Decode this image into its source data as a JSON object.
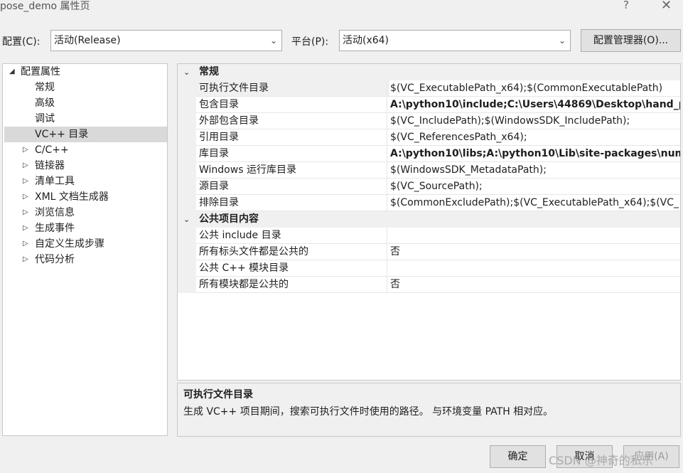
{
  "window": {
    "title": "pose_demo 属性页",
    "help_glyph": "?",
    "close_glyph": "✕"
  },
  "toolbar": {
    "config_label": "配置(C):",
    "config_value": "活动(Release)",
    "platform_label": "平台(P):",
    "platform_value": "活动(x64)",
    "manager_button": "配置管理器(O)..."
  },
  "tree": {
    "root": "配置属性",
    "children": [
      "常规",
      "高级",
      "调试",
      "VC++ 目录"
    ],
    "collapsed": [
      "C/C++",
      "链接器",
      "清单工具",
      "XML 文档生成器",
      "浏览信息",
      "生成事件",
      "自定义生成步骤",
      "代码分析"
    ],
    "selected": "VC++ 目录"
  },
  "grid": {
    "categories": [
      {
        "name": "常规",
        "rows": [
          {
            "name": "可执行文件目录",
            "value": "$(VC_ExecutablePath_x64);$(CommonExecutablePath)",
            "bold": false
          },
          {
            "name": "包含目录",
            "value": "A:\\python10\\include;C:\\Users\\44869\\Desktop\\hand_p",
            "bold": true
          },
          {
            "name": "外部包含目录",
            "value": "$(VC_IncludePath);$(WindowsSDK_IncludePath);",
            "bold": false
          },
          {
            "name": "引用目录",
            "value": "$(VC_ReferencesPath_x64);",
            "bold": false
          },
          {
            "name": "库目录",
            "value": "A:\\python10\\libs;A:\\python10\\Lib\\site-packages\\num",
            "bold": true
          },
          {
            "name": "Windows 运行库目录",
            "value": "$(WindowsSDK_MetadataPath);",
            "bold": false
          },
          {
            "name": "源目录",
            "value": "$(VC_SourcePath);",
            "bold": false
          },
          {
            "name": "排除目录",
            "value": "$(CommonExcludePath);$(VC_ExecutablePath_x64);$(VC_",
            "bold": false
          }
        ]
      },
      {
        "name": "公共项目内容",
        "rows": [
          {
            "name": "公共 include 目录",
            "value": "",
            "bold": false
          },
          {
            "name": "所有标头文件都是公共的",
            "value": "否",
            "bold": false
          },
          {
            "name": "公共 C++ 模块目录",
            "value": "",
            "bold": false
          },
          {
            "name": "所有模块都是公共的",
            "value": "否",
            "bold": false
          }
        ]
      }
    ]
  },
  "description": {
    "title": "可执行文件目录",
    "text": "生成 VC++ 项目期间，搜索可执行文件时使用的路径。 与环境变量 PATH 相对应。"
  },
  "buttons": {
    "ok": "确定",
    "cancel": "取消",
    "apply": "应用(A)"
  },
  "watermark": "CSDN @神奇的私乐"
}
